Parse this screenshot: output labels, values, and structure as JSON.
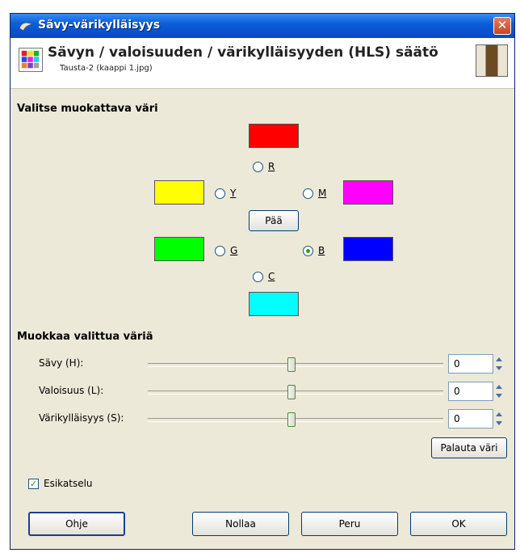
{
  "window": {
    "title": "Sävy-värikylläisyys",
    "close_label": "✕"
  },
  "header": {
    "title": "Sävyn / valoisuuden / värikylläisyyden (HLS) säätö",
    "subtitle": "Tausta-2 (kaappi 1.jpg)"
  },
  "select_section": {
    "label": "Valitse muokattava väri",
    "colors": {
      "R": {
        "label": "R",
        "color": "#ff0000",
        "selected": false
      },
      "Y": {
        "label": "Y",
        "color": "#ffff00",
        "selected": false
      },
      "M": {
        "label": "M",
        "color": "#ff00ff",
        "selected": false
      },
      "G": {
        "label": "G",
        "color": "#00ff00",
        "selected": false
      },
      "B": {
        "label": "B",
        "color": "#0000ff",
        "selected": true
      },
      "C": {
        "label": "C",
        "color": "#00ffff",
        "selected": false
      }
    },
    "master_button": "Pää"
  },
  "edit_section": {
    "label": "Muokkaa valittua väriä",
    "sliders": [
      {
        "label": "Sävy (H):",
        "value": "0"
      },
      {
        "label": "Valoisuus (L):",
        "value": "0"
      },
      {
        "label": "Värikylläisyys (S):",
        "value": "0"
      }
    ],
    "reset_color_button": "Palauta väri"
  },
  "preview": {
    "label": "Esikatselu",
    "checked": true
  },
  "buttons": {
    "help": "Ohje",
    "reset": "Nollaa",
    "cancel": "Peru",
    "ok": "OK"
  }
}
